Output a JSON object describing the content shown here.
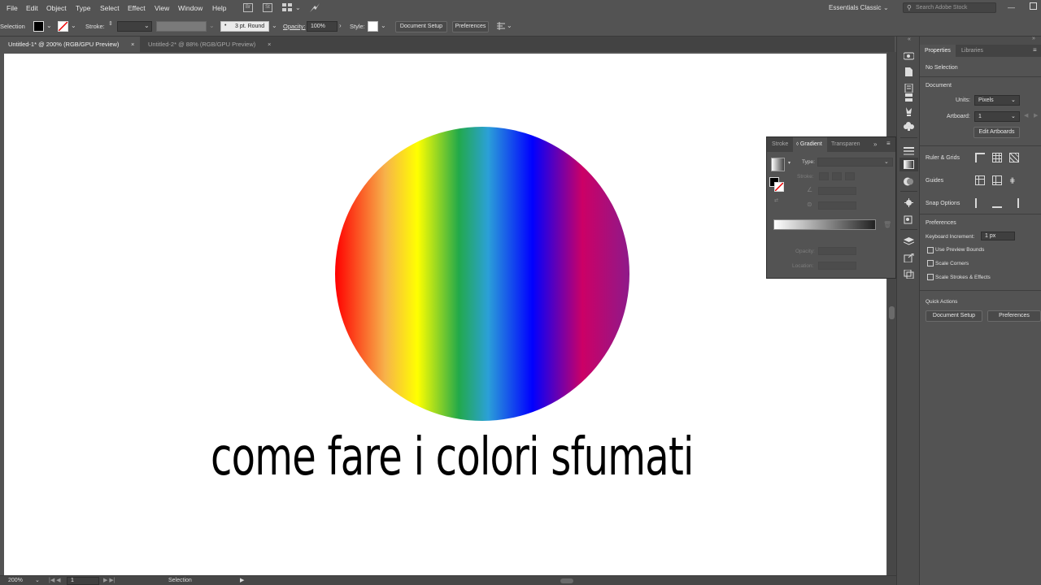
{
  "menubar": {
    "items": [
      "File",
      "Edit",
      "Object",
      "Type",
      "Select",
      "Effect",
      "View",
      "Window",
      "Help"
    ],
    "workspace": "Essentials Classic",
    "search_placeholder": "Search Adobe Stock"
  },
  "controlbar": {
    "selection_label": "Selection",
    "stroke_label": "Stroke:",
    "brush_value": "3 pt. Round",
    "opacity_label": "Opacity:",
    "opacity_value": "100%",
    "style_label": "Style:",
    "document_setup": "Document Setup",
    "preferences": "Preferences"
  },
  "tabs": [
    {
      "label": "Untitled-1* @ 200% (RGB/GPU Preview)",
      "active": true
    },
    {
      "label": "Untitled-2* @ 88% (RGB/GPU Preview)",
      "active": false
    }
  ],
  "canvas": {
    "caption": "come fare i colori sfumati",
    "gradient_stops": [
      "#ff0000",
      "#f7b24a",
      "#ffff00",
      "#22a94a",
      "#2ba0d8",
      "#0000ff",
      "#cc0066",
      "#8e1a8a"
    ]
  },
  "gradient_panel": {
    "tabs": [
      "Stroke",
      "Gradient",
      "Transparen"
    ],
    "type_label": "Type:",
    "stroke_label": "Stroke:",
    "opacity_label": "Opacity:",
    "location_label": "Location:"
  },
  "properties": {
    "tabs": [
      "Properties",
      "Libraries"
    ],
    "no_selection": "No Selection",
    "document_heading": "Document",
    "units_label": "Units:",
    "units_value": "Pixels",
    "artboard_label": "Artboard:",
    "artboard_value": "1",
    "edit_artboards": "Edit Artboards",
    "rulers_grids": "Ruler & Grids",
    "guides": "Guides",
    "snap_options": "Snap Options",
    "preferences_heading": "Preferences",
    "keyboard_increment_label": "Keyboard Increment:",
    "keyboard_increment_value": "1 px",
    "checkboxes": [
      "Use Preview Bounds",
      "Scale Corners",
      "Scale Strokes & Effects"
    ],
    "quick_actions": "Quick Actions",
    "document_setup": "Document Setup",
    "preferences": "Preferences"
  },
  "statusbar": {
    "zoom": "200%",
    "artboard_number": "1",
    "tool": "Selection"
  }
}
